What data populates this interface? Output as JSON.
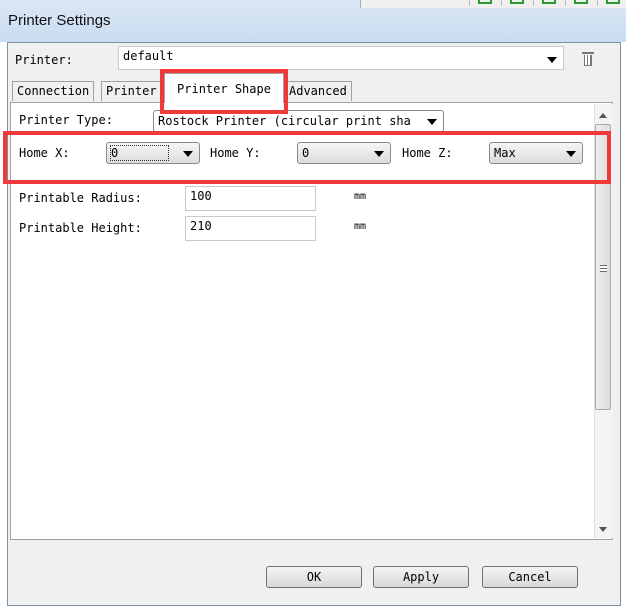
{
  "window": {
    "title": "Printer Settings"
  },
  "printer": {
    "label": "Printer:",
    "value": "default"
  },
  "tabs": [
    {
      "label": "Connection"
    },
    {
      "label": "Printer"
    },
    {
      "label": "Printer Shape",
      "active": true
    },
    {
      "label": "Advanced"
    }
  ],
  "shape": {
    "printer_type_label": "Printer Type:",
    "printer_type_value": "Rostock Printer (circular print sha",
    "home_x_label": "Home X:",
    "home_x_value": "0",
    "home_y_label": "Home Y:",
    "home_y_value": "0",
    "home_z_label": "Home Z:",
    "home_z_value": "Max",
    "radius_label": "Printable Radius:",
    "radius_value": "100",
    "radius_unit": "mm",
    "height_label": "Printable Height:",
    "height_value": "210",
    "height_unit": "mm"
  },
  "buttons": {
    "ok": "OK",
    "apply": "Apply",
    "cancel": "Cancel"
  },
  "highlight_color": "#f03a3a"
}
